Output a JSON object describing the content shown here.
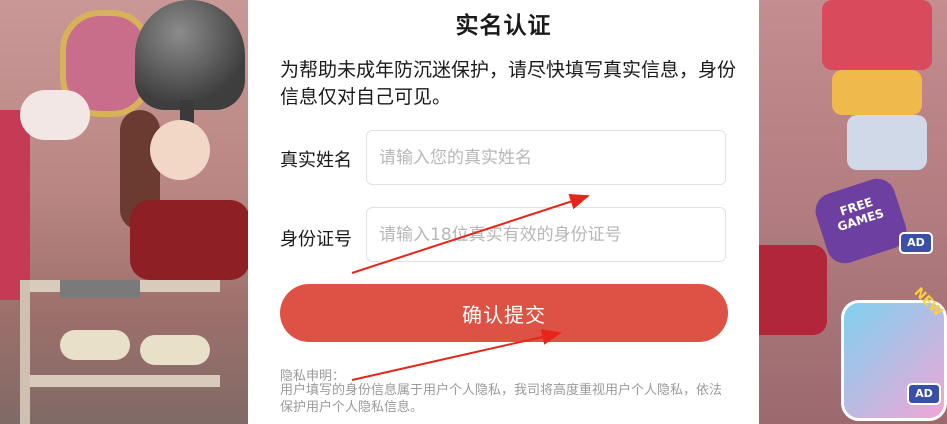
{
  "modal": {
    "title": "实名认证",
    "description": "为帮助未成年防沉迷保护，请尽快填写真实信息，身份信息仅对自己可见。",
    "name_label": "真实姓名",
    "name_placeholder": "请输入您的真实姓名",
    "id_label": "身份证号",
    "id_placeholder": "请输入18位真实有效的身份证号",
    "submit_label": "确认提交",
    "privacy_title": "隐私申明：",
    "privacy_text": "用户填写的身份信息属于用户个人隐私，我司将高度重视用户个人隐私，依法保护用户个人隐私信息。"
  },
  "background": {
    "free_games_label": "FREE GAMES",
    "ad_badge_1": "AD",
    "ad_badge_2": "AD",
    "new_tag": "NEW"
  },
  "colors": {
    "submit_button": "#dd5244",
    "annotation_arrow": "#e8251b"
  },
  "icons": [
    "hair-dryer-icon",
    "mirror-icon",
    "free-games-icon",
    "ad-badge-icon"
  ]
}
